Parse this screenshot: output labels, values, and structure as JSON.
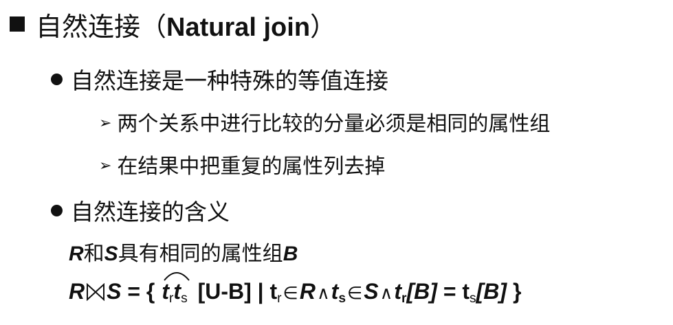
{
  "heading": {
    "cn": "自然连接（",
    "en": "Natural join",
    "close": "）"
  },
  "bullets": [
    {
      "text": "自然连接是一种特殊的等值连接",
      "subs": [
        "两个关系中进行比较的分量必须是相同的属性组",
        "在结果中把重复的属性列去掉"
      ]
    },
    {
      "text": "自然连接的含义"
    }
  ],
  "math_line1": {
    "r": "R",
    "and": "和",
    "s": "S",
    "rest": "具有相同的属性组",
    "b": "B"
  },
  "math_line2": {
    "R": "R",
    "S": "S",
    "eq_open": " = {",
    "t_r": "t",
    "r_sub": "r",
    "t_s": "t",
    "s_sub": "s",
    "ub": " [U-B] | ",
    "tr2": "t",
    "tr2_sub": "r",
    "in1": "∈",
    "R2": "R",
    "and1": "∧",
    "ts2": "t",
    "ts2_sub": "s",
    "in2": "∈",
    "S2": "S",
    "and2": "∧",
    "tr3": "t",
    "tr3_sub": "r",
    "b1": "[B]",
    "eq2": " = ",
    "ts3": "t",
    "ts3_sub": "s",
    "b2": "[B]",
    "close": " }"
  }
}
